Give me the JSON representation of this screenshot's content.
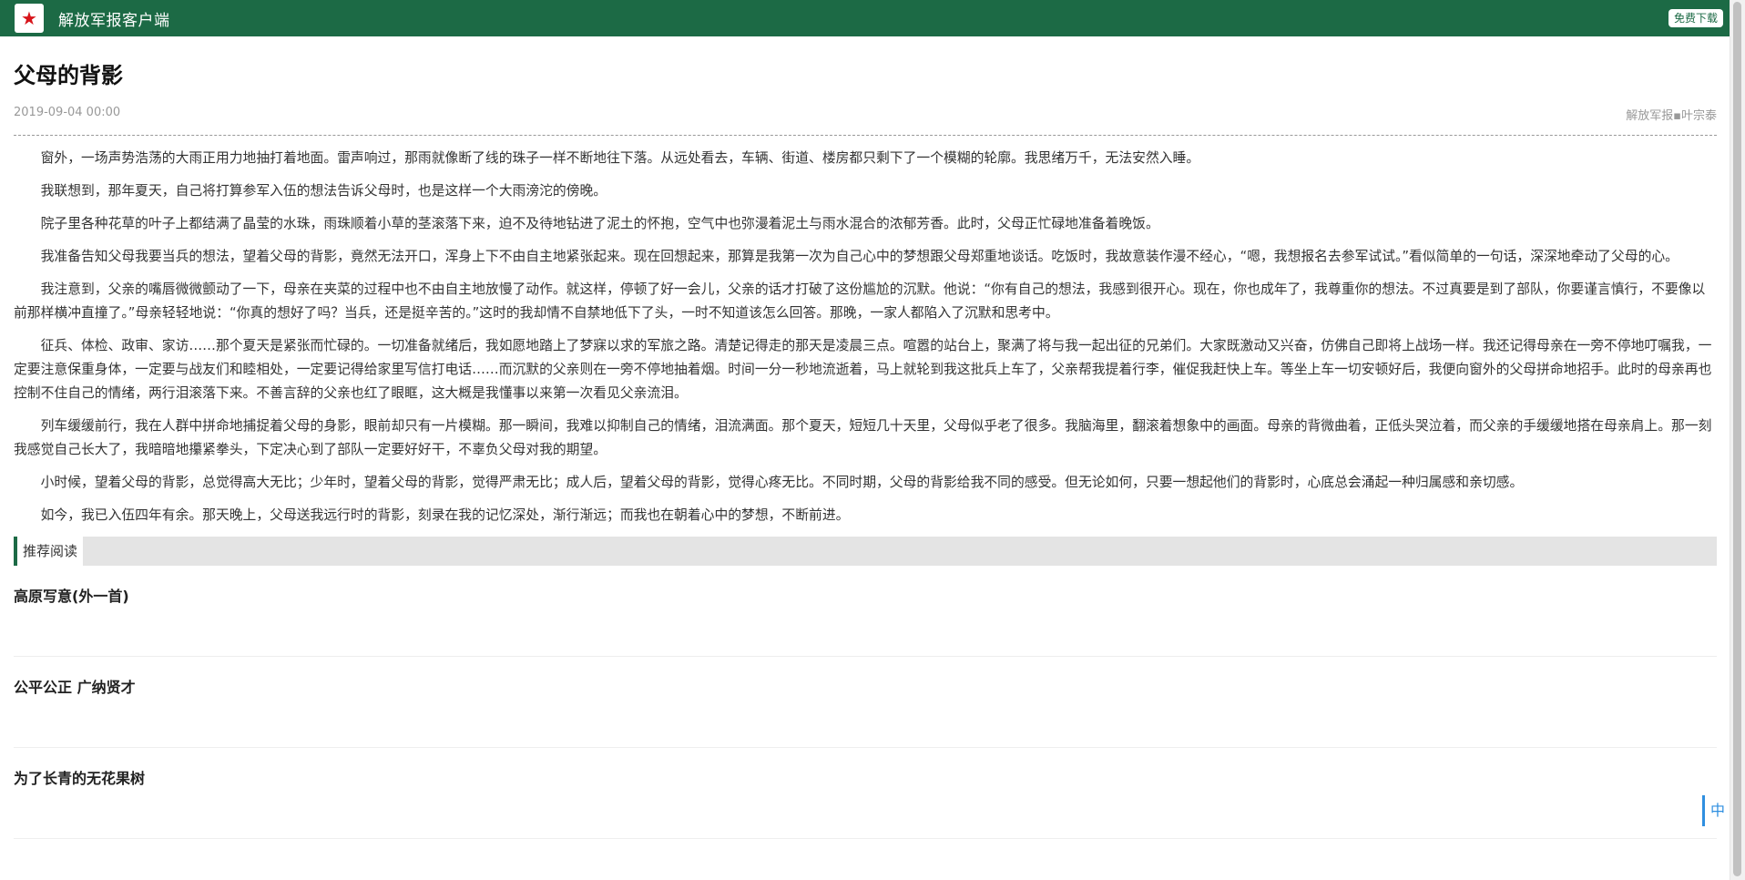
{
  "header": {
    "app_title": "解放军报客户端",
    "download_label": "免费下载",
    "logo_icon": "red-star-logo"
  },
  "article": {
    "title": "父母的背影",
    "date": "2019-09-04 00:00",
    "source": "解放军报▪叶宗泰",
    "paragraphs": [
      "窗外，一场声势浩荡的大雨正用力地抽打着地面。雷声响过，那雨就像断了线的珠子一样不断地往下落。从远处看去，车辆、街道、楼房都只剩下了一个模糊的轮廓。我思绪万千，无法安然入睡。",
      "我联想到，那年夏天，自己将打算参军入伍的想法告诉父母时，也是这样一个大雨滂沱的傍晚。",
      "院子里各种花草的叶子上都结满了晶莹的水珠，雨珠顺着小草的茎滚落下来，迫不及待地钻进了泥土的怀抱，空气中也弥漫着泥土与雨水混合的浓郁芳香。此时，父母正忙碌地准备着晚饭。",
      "我准备告知父母我要当兵的想法，望着父母的背影，竟然无法开口，浑身上下不由自主地紧张起来。现在回想起来，那算是我第一次为自己心中的梦想跟父母郑重地谈话。吃饭时，我故意装作漫不经心，“嗯，我想报名去参军试试。”看似简单的一句话，深深地牵动了父母的心。",
      "我注意到，父亲的嘴唇微微颤动了一下，母亲在夹菜的过程中也不由自主地放慢了动作。就这样，停顿了好一会儿，父亲的话才打破了这份尴尬的沉默。他说：“你有自己的想法，我感到很开心。现在，你也成年了，我尊重你的想法。不过真要是到了部队，你要谨言慎行，不要像以前那样横冲直撞了。”母亲轻轻地说：“你真的想好了吗？当兵，还是挺辛苦的。”这时的我却情不自禁地低下了头，一时不知道该怎么回答。那晚，一家人都陷入了沉默和思考中。",
      "征兵、体检、政审、家访……那个夏天是紧张而忙碌的。一切准备就绪后，我如愿地踏上了梦寐以求的军旅之路。清楚记得走的那天是凌晨三点。喧嚣的站台上，聚满了将与我一起出征的兄弟们。大家既激动又兴奋，仿佛自己即将上战场一样。我还记得母亲在一旁不停地叮嘱我，一定要注意保重身体，一定要与战友们和睦相处，一定要记得给家里写信打电话……而沉默的父亲则在一旁不停地抽着烟。时间一分一秒地流逝着，马上就轮到我这批兵上车了，父亲帮我提着行李，催促我赶快上车。等坐上车一切安顿好后，我便向窗外的父母拼命地招手。此时的母亲再也控制不住自己的情绪，两行泪滚落下来。不善言辞的父亲也红了眼眶，这大概是我懂事以来第一次看见父亲流泪。",
      "列车缓缓前行，我在人群中拼命地捕捉着父母的身影，眼前却只有一片模糊。那一瞬间，我难以抑制自己的情绪，泪流满面。那个夏天，短短几十天里，父母似乎老了很多。我脑海里，翻滚着想象中的画面。母亲的背微曲着，正低头哭泣着，而父亲的手缓缓地搭在母亲肩上。那一刻我感觉自己长大了，我暗暗地攥紧拳头，下定决心到了部队一定要好好干，不辜负父母对我的期望。",
      "小时候，望着父母的背影，总觉得高大无比；少年时，望着父母的背影，觉得严肃无比；成人后，望着父母的背影，觉得心疼无比。不同时期，父母的背影给我不同的感受。但无论如何，只要一想起他们的背影时，心底总会涌起一种归属感和亲切感。",
      "如今，我已入伍四年有余。那天晚上，父母送我远行时的背影，刻录在我的记忆深处，渐行渐远；而我也在朝着心中的梦想，不断前进。"
    ]
  },
  "recommend": {
    "section_title": "推荐阅读",
    "items": [
      {
        "title": "高原写意(外一首)"
      },
      {
        "title": "公平公正 广纳贤才"
      },
      {
        "title": "为了长青的无花果树"
      }
    ]
  },
  "floating": {
    "lang_label": "中"
  },
  "colors": {
    "brand_green": "#1c6a45",
    "accent_blue": "#2f8fe0"
  }
}
